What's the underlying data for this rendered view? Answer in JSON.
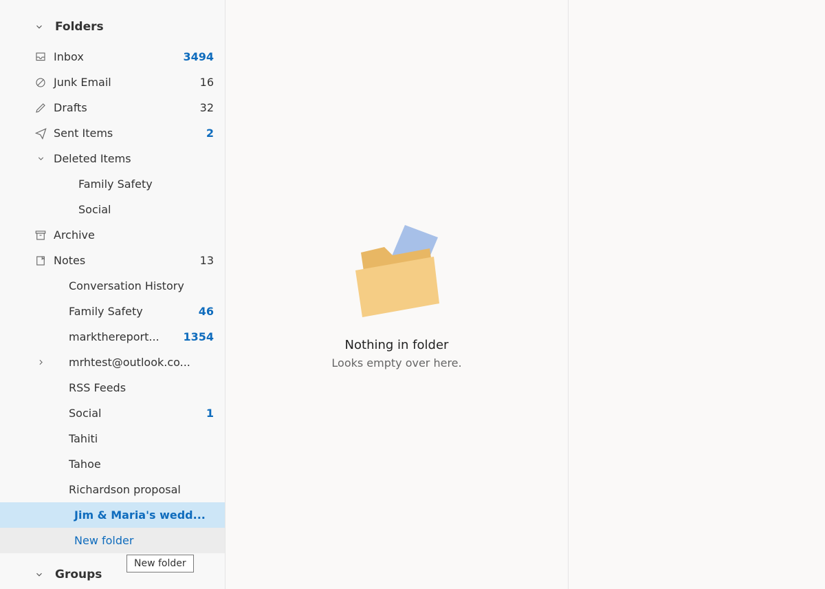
{
  "sidebar": {
    "folders_header": "Folders",
    "inbox": {
      "label": "Inbox",
      "count": "3494"
    },
    "junk": {
      "label": "Junk Email",
      "count": "16"
    },
    "drafts": {
      "label": "Drafts",
      "count": "32"
    },
    "sent": {
      "label": "Sent Items",
      "count": "2"
    },
    "deleted": {
      "label": "Deleted Items"
    },
    "deleted_children": {
      "family_safety": "Family Safety",
      "social": "Social"
    },
    "archive": {
      "label": "Archive"
    },
    "notes": {
      "label": "Notes",
      "count": "13"
    },
    "conversation_history": "Conversation History",
    "family_safety2": {
      "label": "Family Safety",
      "count": "46"
    },
    "markthereport": {
      "label": "markthereport...",
      "count": "1354"
    },
    "mrhtest": {
      "label": "mrhtest@outlook.co..."
    },
    "rss": "RSS Feeds",
    "social2": {
      "label": "Social",
      "count": "1"
    },
    "tahiti": "Tahiti",
    "tahoe": "Tahoe",
    "richardson": "Richardson proposal",
    "jim_maria": "Jim & Maria's wedd...",
    "new_folder": "New folder",
    "groups_header": "Groups"
  },
  "tooltip": "New folder",
  "empty": {
    "title": "Nothing in folder",
    "sub": "Looks empty over here."
  }
}
